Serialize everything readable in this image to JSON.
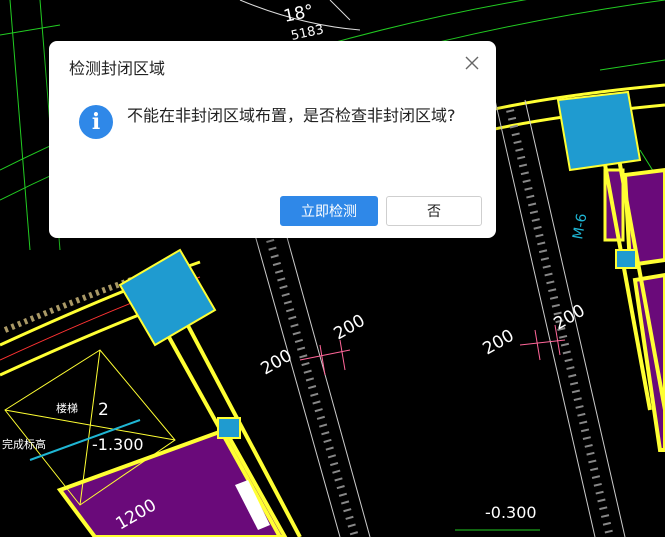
{
  "cad_labels": {
    "angle": "18°",
    "code": "5183",
    "dim_200_a": "200",
    "dim_200_b": "200",
    "dim_200_c": "200",
    "dim_200_d": "200",
    "dim_1200": "1200",
    "elev_1": "-1.300",
    "elev_2": "-0.300",
    "num_2": "2",
    "stair_label": "楼梯",
    "side_label": "完成标高",
    "side_mark": "M-6"
  },
  "dialog": {
    "title": "检测封闭区域",
    "message": "不能在非封闭区域布置，是否检查非封闭区域?",
    "primary_label": "立即检测",
    "secondary_label": "否",
    "info_glyph": "i",
    "close_glyph": "✕"
  },
  "colors": {
    "primary": "#2f88e8",
    "wall_yellow": "#ffff33",
    "room_purple": "#6a0a7a",
    "column_cyan": "#1f9bd0",
    "line_green": "#22cc22"
  }
}
